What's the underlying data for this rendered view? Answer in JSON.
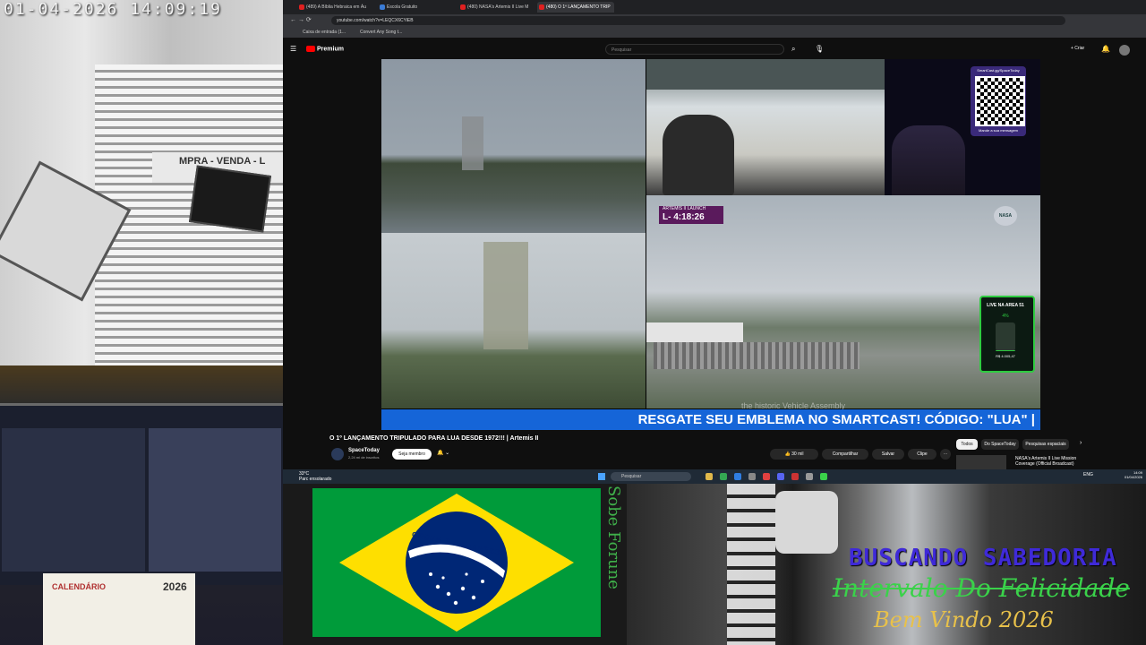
{
  "cam_top_left": {
    "timestamp": "01-04-2026  14:09:19",
    "shop_sign": "MPRA - VENDA - L"
  },
  "cam_bottom_left": {
    "calendar_label": "CALENDÁRIO",
    "calendar_year": "2026"
  },
  "browser": {
    "tabs": [
      {
        "label": "(489) A Bíblia Hebraica em Áu"
      },
      {
        "label": "Escola Gratuito"
      },
      {
        "label": "(480) NASA's Artemis II Live M"
      },
      {
        "label": "(480) O 1º LANÇAMENTO TRIP"
      }
    ],
    "url": "youtube.com/watch?v=LEQCX6CYiEB",
    "bookmarks": [
      "Caixa de entrada (1...",
      "Convert Any Song t..."
    ]
  },
  "youtube": {
    "logo": "Premium",
    "search_placeholder": "Pesquisar",
    "create_label": "+ Criar",
    "video": {
      "artemis_label": "ARTEMIS II LAUNCH",
      "countdown": "L- 4:18:26",
      "nasa_label": "NASA",
      "qr_top": "SmartCast.gg/SpaceToday",
      "qr_bottom": "Mande a sua mensagem",
      "live_widget": {
        "title": "LIVE NA AREA 51",
        "percent_text": "4%",
        "percent": 0.04,
        "amount": "R$ 4.005,47"
      },
      "caption": "the historic Vehicle Assembly",
      "ticker": "RESGATE SEU EMBLEMA NO SMARTCAST! CÓDIGO: \"LUA\" |"
    },
    "title": "O 1º LANÇAMENTO TRIPULADO PARA LUA DESDE 1972!!! | Artemis II",
    "channel": "SpaceToday",
    "subscribers": "2,24 mi de inscritos",
    "join_label": "Seja membro",
    "actions": [
      {
        "label": "30 mil"
      },
      {
        "label": "Compartilhar"
      },
      {
        "label": "Salvar"
      },
      {
        "label": "Clipe"
      }
    ],
    "chips": [
      "Todos",
      "Do SpaceToday",
      "Pesquisas espaciais"
    ],
    "recommendation": "NASA's Artemis II Live Mission Coverage (Official Broadcast)"
  },
  "taskbar": {
    "weather_temp": "33°C",
    "weather_desc": "Parc ensolarado",
    "search_label": "Pesquisar",
    "language": "ENG",
    "time": "14:09",
    "date": "01/04/2026"
  },
  "flag": {
    "motto": "ORDEM E PROGRESSO"
  },
  "side_label": "Sobe Forune",
  "overlays": {
    "line1": "BUSCANDO SABEDORIA",
    "line2": "Intervalo Do Felicidade",
    "line3": "Bem Vindo 2026"
  },
  "colors": {
    "flag_green": "#009b3a",
    "flag_yellow": "#fedf00",
    "flag_blue": "#002776",
    "ticker_blue": "#1565d8",
    "live_green": "#2ecc40"
  }
}
